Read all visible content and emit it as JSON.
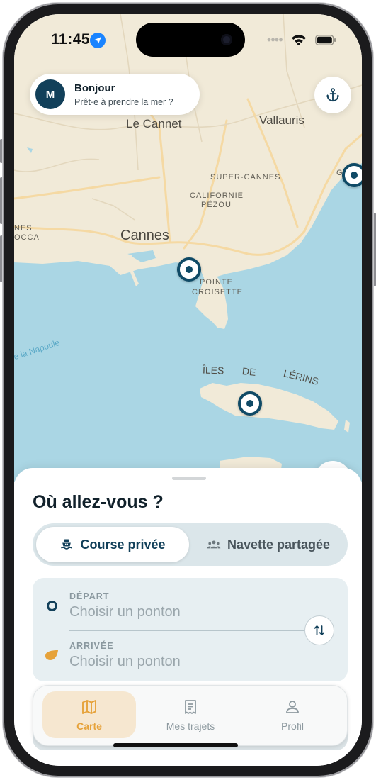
{
  "status_bar": {
    "time": "11:45",
    "location_icon": "location-arrow-icon",
    "signal_icon": "cellular-dots-icon",
    "wifi_icon": "wifi-icon",
    "battery_icon": "battery-icon"
  },
  "map": {
    "labels": {
      "le_cannet": "Le Cannet",
      "vallauris": "Vallauris",
      "super_cannes": "SUPER-CANNES",
      "californie": "CALIFORNIE",
      "pezou": "PÉZOU",
      "cannes": "Cannes",
      "pointe": "POINTE",
      "croisette": "CROISETTE",
      "nes": "NES",
      "occa": "OCCA",
      "napoule": "e la Napoule",
      "edge_g": "G",
      "lerins": "ÎLES DE LÉRINS"
    },
    "colors": {
      "land": "#f1ead8",
      "water": "#aad6e4",
      "road": "#f5d9a3",
      "pin": "#0f4a66"
    }
  },
  "greeting": {
    "avatar_initial": "M",
    "title": "Bonjour",
    "subtitle": "Prêt·e à prendre la mer ?"
  },
  "anchor_button_icon": "anchor-icon",
  "sheet": {
    "title": "Où allez-vous ?",
    "segments": [
      {
        "label": "Course privée",
        "icon": "boat-icon",
        "selected": true
      },
      {
        "label": "Navette partagée",
        "icon": "group-icon",
        "selected": false
      }
    ],
    "departure": {
      "caption": "DÉPART",
      "value": "Choisir un ponton"
    },
    "arrival": {
      "caption": "ARRIVÉE",
      "value": "Choisir un ponton"
    },
    "swap_icon": "swap-vertical-icon"
  },
  "tabs": [
    {
      "label": "Carte",
      "icon": "map-icon",
      "active": true
    },
    {
      "label": "Mes trajets",
      "icon": "receipt-icon",
      "active": false
    },
    {
      "label": "Profil",
      "icon": "person-icon",
      "active": false
    }
  ],
  "colors": {
    "primary": "#12405a",
    "accent": "#e6a23a",
    "accent_bg": "#f6e7d0"
  }
}
